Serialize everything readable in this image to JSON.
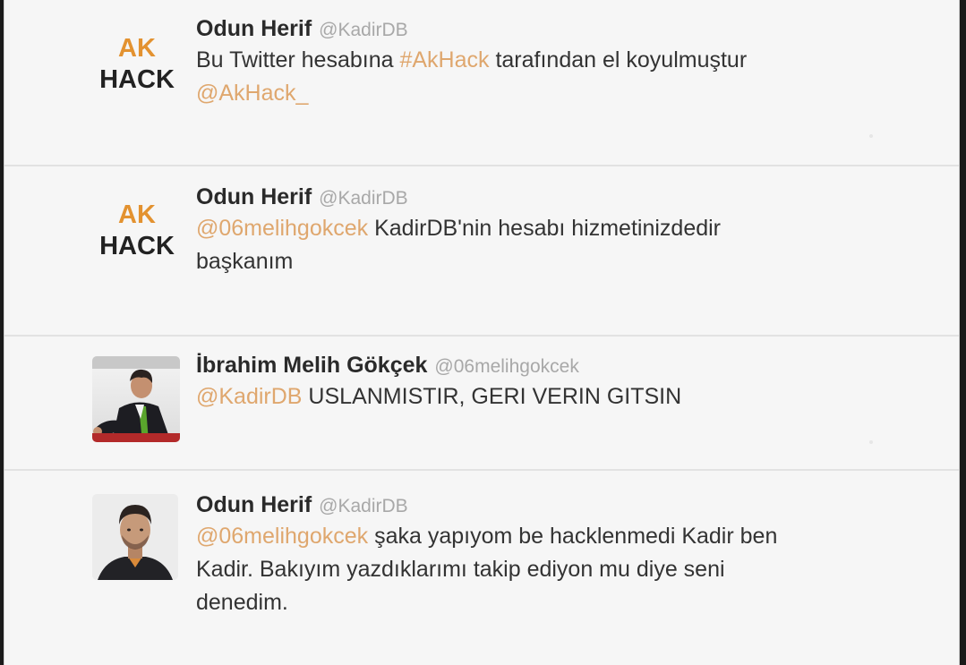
{
  "tweets": [
    {
      "avatar": {
        "type": "akhack",
        "top": "AK",
        "bottom": "HACK"
      },
      "name": "Odun Herif",
      "handle": "@KadirDB",
      "text": {
        "p1": "Bu Twitter hesabına ",
        "hashtag": "#AkHack",
        "p2": " tarafından el koyulmuştur",
        "mention": "@AkHack_"
      }
    },
    {
      "avatar": {
        "type": "akhack",
        "top": "AK",
        "bottom": "HACK"
      },
      "name": "Odun Herif",
      "handle": "@KadirDB",
      "text": {
        "mention": "@06melihgokcek",
        "p1": " KadirDB'nin hesabı hizmetinizdedir",
        "p2": "başkanım"
      }
    },
    {
      "avatar": {
        "type": "photo",
        "icon": "politician-avatar"
      },
      "name": "İbrahim Melih Gökçek",
      "handle": "@06melihgokcek",
      "text": {
        "mention": "@KadirDB",
        "p1": " USLANMISTIR, GERI VERIN GITSIN"
      }
    },
    {
      "avatar": {
        "type": "photo",
        "icon": "young-man-avatar"
      },
      "name": "Odun Herif",
      "handle": "@KadirDB",
      "text": {
        "mention": "@06melihgokcek",
        "p1": " şaka yapıyom be hacklenmedi Kadir ben",
        "p2": "Kadir. Bakıyım yazdıklarımı takip ediyon mu diye seni",
        "p3": "denedim."
      }
    }
  ],
  "colors": {
    "link": "#dfa76e",
    "akhack_orange": "#e39230",
    "handle": "#a8a8a8"
  }
}
